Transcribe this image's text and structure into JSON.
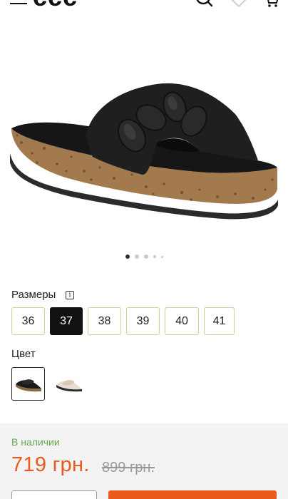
{
  "header": {
    "logo": "ccc",
    "icons": [
      "hamburger-icon",
      "search-icon",
      "heart-icon",
      "cart-icon"
    ]
  },
  "product": {
    "image_alt": "Black slide sandal with chain strap and cork sole",
    "carousel": {
      "total_images": 5,
      "active_index": 0
    }
  },
  "sizes": {
    "label": "Размеры",
    "info_icon": "i",
    "options": [
      "36",
      "37",
      "38",
      "39",
      "40",
      "41"
    ],
    "selected": "37"
  },
  "colors": {
    "label": "Цвет",
    "options": [
      "black",
      "beige"
    ],
    "selected": "black"
  },
  "purchase": {
    "availability": "В наличии",
    "price": "719 грн.",
    "old_price": "899 грн."
  },
  "theme": {
    "accent": "#ea5a1a",
    "available": "#6aa84f",
    "size_border": "#d8cc9c"
  }
}
